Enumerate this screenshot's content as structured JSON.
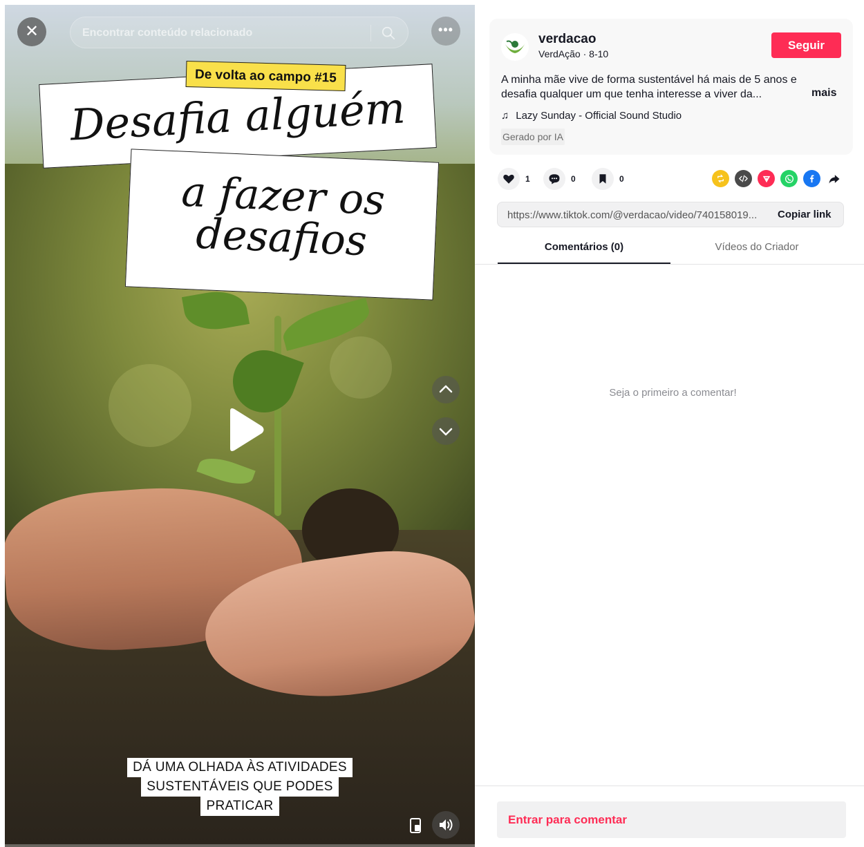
{
  "video": {
    "search_placeholder": "Encontrar conteúdo relacionado",
    "tag_label": "De volta ao campo #15",
    "title_line1": "Desafia alguém",
    "title_line2a": "a fazer os",
    "title_line2b": "desafios",
    "caption_lines": [
      "DÁ UMA OLHADA ÀS ATIVIDADES",
      "SUSTENTÁVEIS QUE PODES",
      "PRATICAR"
    ]
  },
  "post": {
    "username": "verdacao",
    "subline": "VerdAção · 8-10",
    "follow_label": "Seguir",
    "description": "A minha mãe vive de forma sustentável há mais de 5 anos e desafia qualquer um que tenha interesse a viver da...",
    "more_label": "mais",
    "music": "Lazy Sunday - Official Sound Studio",
    "ai_badge": "Gerado por IA"
  },
  "stats": {
    "likes": "1",
    "comments": "0",
    "saves": "0"
  },
  "share_icons": [
    "repost-icon",
    "embed-icon",
    "send-icon",
    "whatsapp-icon",
    "facebook-icon",
    "share-arrow-icon"
  ],
  "link": {
    "url": "https://www.tiktok.com/@verdacao/video/740158019...",
    "copy_label": "Copiar link"
  },
  "tabs": {
    "comments": "Comentários (0)",
    "creator_videos": "Vídeos do Criador"
  },
  "empty_comments": "Seja o primeiro a comentar!",
  "login_comment": "Entrar para comentar",
  "colors": {
    "accent": "#fe2c55",
    "tag_yellow": "#f9e04a",
    "repost": "#f6c21c",
    "embed": "#4a4a4a",
    "send": "#fe2c55",
    "whatsapp": "#25d366",
    "facebook": "#1877f2"
  }
}
